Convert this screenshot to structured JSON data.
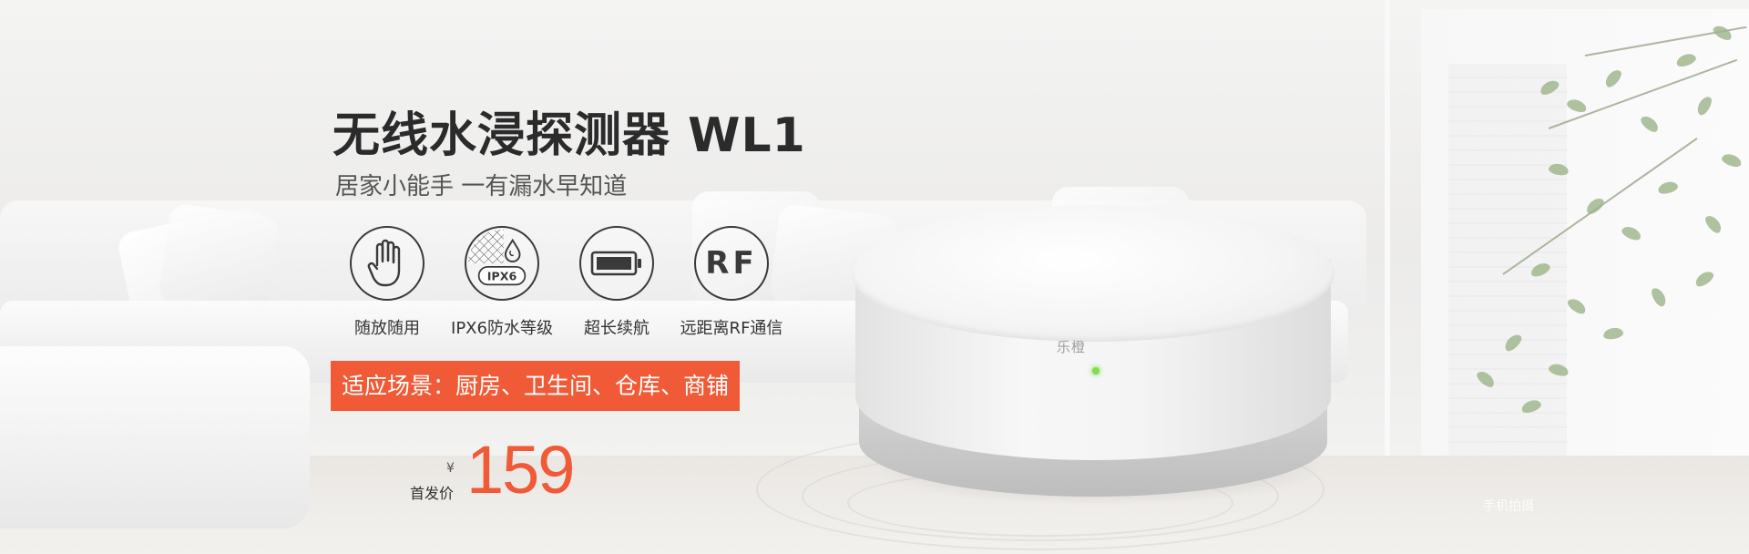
{
  "banner": {
    "title": "无线水浸探测器 WL1",
    "subtitle": "居家小能手 一有漏水早知道",
    "features": [
      {
        "icon": "hand-icon",
        "label": "随放随用"
      },
      {
        "icon": "ipx6-water-icon",
        "label": "IPX6防水等级",
        "badge": "IPX6"
      },
      {
        "icon": "battery-icon",
        "label": "超长续航"
      },
      {
        "icon": "rf-icon",
        "label": "远距离RF通信",
        "badge": "RF"
      }
    ],
    "scenario": "适应场景：厨房、卫生间、仓库、商铺",
    "price": {
      "label": "首发价",
      "currency": "¥",
      "value": "159"
    },
    "device_logo": "乐橙",
    "watermark": "手机拍摄"
  },
  "colors": {
    "accent": "#f05a36",
    "title": "#2b2b2b",
    "led": "#7be04a"
  }
}
